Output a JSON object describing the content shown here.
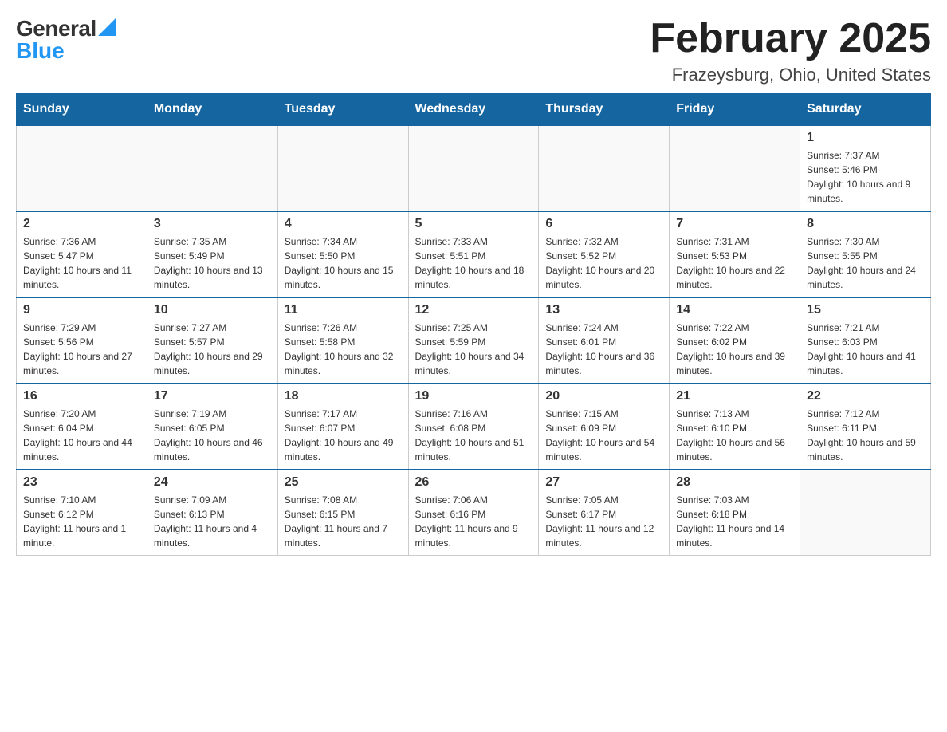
{
  "logo": {
    "general": "General",
    "blue": "Blue"
  },
  "title": "February 2025",
  "subtitle": "Frazeysburg, Ohio, United States",
  "days_of_week": [
    "Sunday",
    "Monday",
    "Tuesday",
    "Wednesday",
    "Thursday",
    "Friday",
    "Saturday"
  ],
  "weeks": [
    [
      {
        "day": "",
        "info": ""
      },
      {
        "day": "",
        "info": ""
      },
      {
        "day": "",
        "info": ""
      },
      {
        "day": "",
        "info": ""
      },
      {
        "day": "",
        "info": ""
      },
      {
        "day": "",
        "info": ""
      },
      {
        "day": "1",
        "info": "Sunrise: 7:37 AM\nSunset: 5:46 PM\nDaylight: 10 hours and 9 minutes."
      }
    ],
    [
      {
        "day": "2",
        "info": "Sunrise: 7:36 AM\nSunset: 5:47 PM\nDaylight: 10 hours and 11 minutes."
      },
      {
        "day": "3",
        "info": "Sunrise: 7:35 AM\nSunset: 5:49 PM\nDaylight: 10 hours and 13 minutes."
      },
      {
        "day": "4",
        "info": "Sunrise: 7:34 AM\nSunset: 5:50 PM\nDaylight: 10 hours and 15 minutes."
      },
      {
        "day": "5",
        "info": "Sunrise: 7:33 AM\nSunset: 5:51 PM\nDaylight: 10 hours and 18 minutes."
      },
      {
        "day": "6",
        "info": "Sunrise: 7:32 AM\nSunset: 5:52 PM\nDaylight: 10 hours and 20 minutes."
      },
      {
        "day": "7",
        "info": "Sunrise: 7:31 AM\nSunset: 5:53 PM\nDaylight: 10 hours and 22 minutes."
      },
      {
        "day": "8",
        "info": "Sunrise: 7:30 AM\nSunset: 5:55 PM\nDaylight: 10 hours and 24 minutes."
      }
    ],
    [
      {
        "day": "9",
        "info": "Sunrise: 7:29 AM\nSunset: 5:56 PM\nDaylight: 10 hours and 27 minutes."
      },
      {
        "day": "10",
        "info": "Sunrise: 7:27 AM\nSunset: 5:57 PM\nDaylight: 10 hours and 29 minutes."
      },
      {
        "day": "11",
        "info": "Sunrise: 7:26 AM\nSunset: 5:58 PM\nDaylight: 10 hours and 32 minutes."
      },
      {
        "day": "12",
        "info": "Sunrise: 7:25 AM\nSunset: 5:59 PM\nDaylight: 10 hours and 34 minutes."
      },
      {
        "day": "13",
        "info": "Sunrise: 7:24 AM\nSunset: 6:01 PM\nDaylight: 10 hours and 36 minutes."
      },
      {
        "day": "14",
        "info": "Sunrise: 7:22 AM\nSunset: 6:02 PM\nDaylight: 10 hours and 39 minutes."
      },
      {
        "day": "15",
        "info": "Sunrise: 7:21 AM\nSunset: 6:03 PM\nDaylight: 10 hours and 41 minutes."
      }
    ],
    [
      {
        "day": "16",
        "info": "Sunrise: 7:20 AM\nSunset: 6:04 PM\nDaylight: 10 hours and 44 minutes."
      },
      {
        "day": "17",
        "info": "Sunrise: 7:19 AM\nSunset: 6:05 PM\nDaylight: 10 hours and 46 minutes."
      },
      {
        "day": "18",
        "info": "Sunrise: 7:17 AM\nSunset: 6:07 PM\nDaylight: 10 hours and 49 minutes."
      },
      {
        "day": "19",
        "info": "Sunrise: 7:16 AM\nSunset: 6:08 PM\nDaylight: 10 hours and 51 minutes."
      },
      {
        "day": "20",
        "info": "Sunrise: 7:15 AM\nSunset: 6:09 PM\nDaylight: 10 hours and 54 minutes."
      },
      {
        "day": "21",
        "info": "Sunrise: 7:13 AM\nSunset: 6:10 PM\nDaylight: 10 hours and 56 minutes."
      },
      {
        "day": "22",
        "info": "Sunrise: 7:12 AM\nSunset: 6:11 PM\nDaylight: 10 hours and 59 minutes."
      }
    ],
    [
      {
        "day": "23",
        "info": "Sunrise: 7:10 AM\nSunset: 6:12 PM\nDaylight: 11 hours and 1 minute."
      },
      {
        "day": "24",
        "info": "Sunrise: 7:09 AM\nSunset: 6:13 PM\nDaylight: 11 hours and 4 minutes."
      },
      {
        "day": "25",
        "info": "Sunrise: 7:08 AM\nSunset: 6:15 PM\nDaylight: 11 hours and 7 minutes."
      },
      {
        "day": "26",
        "info": "Sunrise: 7:06 AM\nSunset: 6:16 PM\nDaylight: 11 hours and 9 minutes."
      },
      {
        "day": "27",
        "info": "Sunrise: 7:05 AM\nSunset: 6:17 PM\nDaylight: 11 hours and 12 minutes."
      },
      {
        "day": "28",
        "info": "Sunrise: 7:03 AM\nSunset: 6:18 PM\nDaylight: 11 hours and 14 minutes."
      },
      {
        "day": "",
        "info": ""
      }
    ]
  ]
}
